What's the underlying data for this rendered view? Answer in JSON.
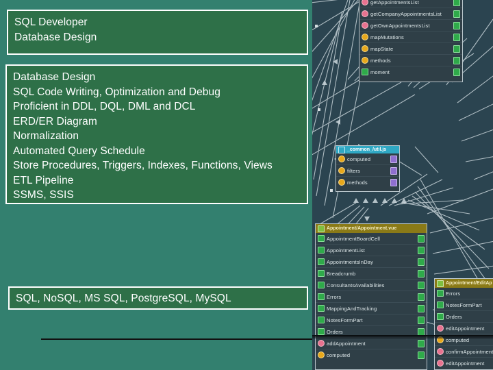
{
  "slide": {
    "title_box": {
      "lines": [
        "SQL Developer",
        "Database Design"
      ]
    },
    "skills_box": {
      "lines": [
        "Database Design",
        "SQL Code Writing, Optimization and Debug",
        "Proficient in DDL, DQL, DML and DCL",
        "ERD/ER Diagram",
        "Normalization",
        "Automated Query Schedule",
        "Store Procedures, Triggers, Indexes, Functions, Views",
        "ETL Pipeline",
        "SSMS, SSIS"
      ]
    },
    "databases_box": {
      "lines": [
        "SQL, NoSQL, MS SQL, PostgreSQL, MySQL"
      ]
    },
    "colors": {
      "background": "#33806f",
      "box_fill": "#2e7048",
      "box_border": "#ffffff",
      "text": "#ffffff",
      "rule": "#111111"
    }
  },
  "diagram": {
    "colors": {
      "panel_background": "#2b4450",
      "node_fill": "#2f3f47",
      "node_border": "#b9c6cc",
      "header_olive": "#8a7a17",
      "header_cyan": "#2fa8c4",
      "icon_method": "#e8728f",
      "icon_computed": "#e8a81b",
      "icon_component": "#2faa4a",
      "edge": "#cdd8dd"
    },
    "nodes": [
      {
        "name": "top-members-node",
        "header": "",
        "rows": [
          {
            "label": "getAppointmentsList",
            "icon": "method-icon"
          },
          {
            "label": "getCompanyAppointmentsList",
            "icon": "method-icon"
          },
          {
            "label": "getOwnAppointmentsList",
            "icon": "method-icon"
          },
          {
            "label": "mapMutations",
            "icon": "computed-icon"
          },
          {
            "label": "mapState",
            "icon": "computed-icon"
          },
          {
            "label": "methods",
            "icon": "computed-icon"
          },
          {
            "label": "moment",
            "icon": "component-icon"
          }
        ]
      },
      {
        "name": "common-util-node",
        "header": "_common_/util.js",
        "header_icon": "file-js-icon",
        "rows": [
          {
            "label": "computed",
            "icon": "computed-icon"
          },
          {
            "label": "filters",
            "icon": "computed-icon"
          },
          {
            "label": "methods",
            "icon": "computed-icon"
          }
        ]
      },
      {
        "name": "appointment-vue-node",
        "header": "Appointment/Appointment.vue",
        "header_icon": "file-vue-icon",
        "rows": [
          {
            "label": "AppointmentBoardCell",
            "icon": "component-icon"
          },
          {
            "label": "AppointmentList",
            "icon": "component-icon"
          },
          {
            "label": "AppointmentsInDay",
            "icon": "component-icon"
          },
          {
            "label": "Breadcrumb",
            "icon": "component-icon"
          },
          {
            "label": "ConsultantsAvailabilities",
            "icon": "component-icon"
          },
          {
            "label": "Errors",
            "icon": "component-icon"
          },
          {
            "label": "MappingAndTracking",
            "icon": "component-icon"
          },
          {
            "label": "NotesFormPart",
            "icon": "component-icon"
          },
          {
            "label": "Orders",
            "icon": "component-icon"
          },
          {
            "label": "addAppointment",
            "icon": "method-icon"
          },
          {
            "label": "computed",
            "icon": "computed-icon"
          }
        ]
      },
      {
        "name": "appointment-edit-node",
        "header": "Appointment/EditAp",
        "header_icon": "file-vue-icon",
        "rows": [
          {
            "label": "Errors",
            "icon": "component-icon"
          },
          {
            "label": "NotesFormPart",
            "icon": "component-icon"
          },
          {
            "label": "Orders",
            "icon": "component-icon"
          },
          {
            "label": "editAppointment",
            "icon": "method-icon"
          },
          {
            "label": "computed",
            "icon": "computed-icon"
          },
          {
            "label": "confirmAppointment",
            "icon": "method-icon"
          },
          {
            "label": "editAppointment",
            "icon": "method-icon"
          }
        ]
      }
    ]
  }
}
